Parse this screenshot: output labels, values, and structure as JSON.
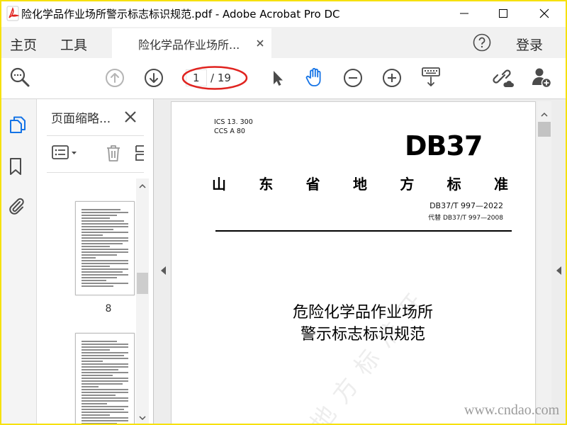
{
  "app": {
    "window_title": "险化学品作业场所警示标志标识规范.pdf - Adobe Acrobat Pro DC"
  },
  "menu_bar": {
    "home": "主页",
    "tools": "工具",
    "document_tab": "险化学品作业场所...",
    "sign_in": "登录"
  },
  "toolbar": {
    "current_page": "1",
    "total_pages": "/ 19"
  },
  "thumbnails_panel": {
    "title": "页面缩略...",
    "page_label": "8"
  },
  "document": {
    "ics": "ICS  13. 300",
    "ccs": "CCS  A  80",
    "standard_logo": "DB37",
    "issuer": [
      "山",
      "东",
      "省",
      "地",
      "方",
      "标",
      "准"
    ],
    "standard_number": "DB37/T  997—2022",
    "replaces": "代替  DB37/T  997—2008",
    "title_line_1": "危险化学品作业场所",
    "title_line_2": "警示标志标识规范",
    "diagonal_watermark": "地方标准开"
  },
  "site_watermark": "www.cndao.com",
  "state": {
    "active_tool": "hand-icon",
    "active_sidebar_item": "pages-icon",
    "previous_page_disabled": true
  },
  "icons": {
    "titlebar": [
      "acrobat-app-icon",
      "minimize-icon",
      "maximize-icon",
      "close-icon"
    ],
    "menu_bar": [
      "tab-close-icon",
      "help-icon"
    ],
    "toolbar": [
      "find-icon",
      "previous-page-icon",
      "next-page-icon",
      "select-pointer-icon",
      "hand-icon",
      "zoom-out-icon",
      "zoom-in-icon",
      "scroll-mode-icon",
      "share-link-icon",
      "add-user-icon"
    ],
    "sidebar": [
      "pages-icon",
      "bookmark-icon",
      "attachment-icon"
    ],
    "thumbnails_panel": [
      "panel-close-icon",
      "options-icon",
      "trash-icon",
      "insert-page-icon"
    ]
  },
  "colors": {
    "accent": "#1473e6",
    "annotation_ellipse": "#e0231f",
    "frame": "#f6e10e",
    "icon": "#4b4b4b",
    "disabled_icon": "#b5b5b5"
  }
}
